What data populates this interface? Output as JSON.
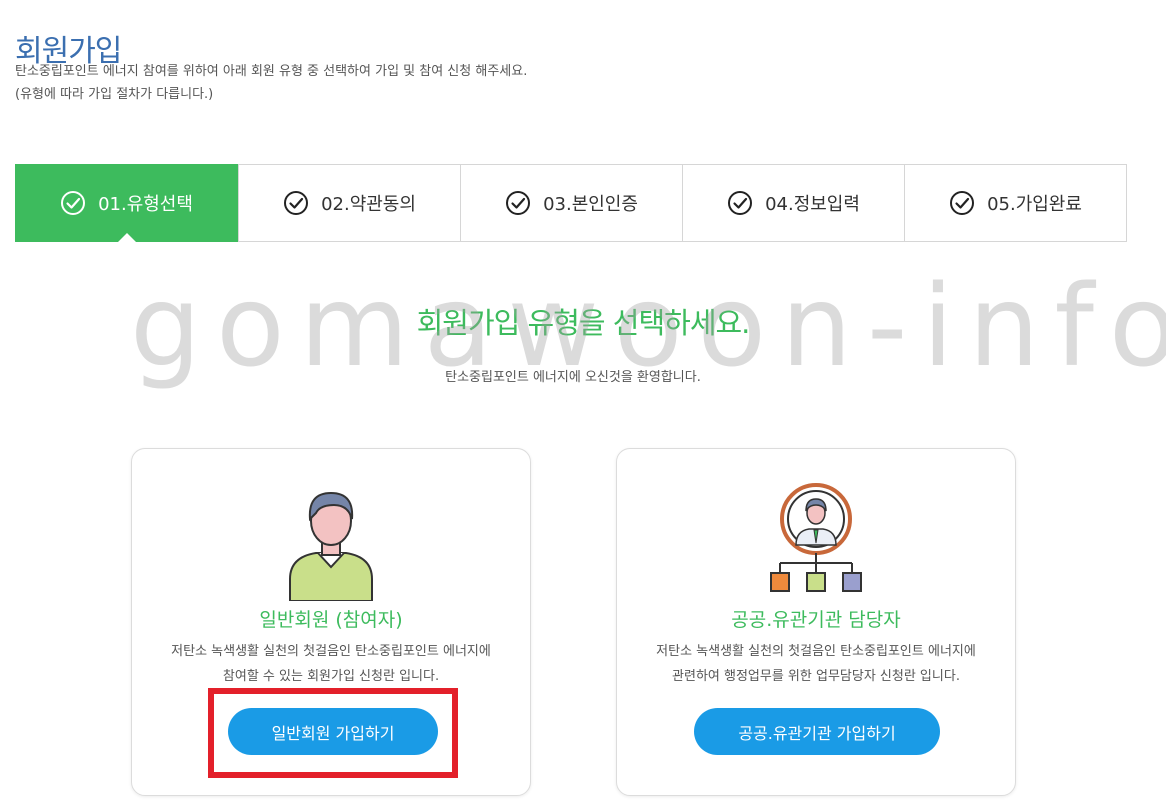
{
  "page": {
    "title": "회원가입",
    "intro_line1": "탄소중립포인트 에너지 참여를 위하여 아래 회원 유형 중 선택하여 가입 및 참여 신청 해주세요.",
    "intro_line2": "(유형에 따라 가입 절차가 다릅니다.)"
  },
  "steps": [
    {
      "label": "01.유형선택",
      "active": true
    },
    {
      "label": "02.약관동의",
      "active": false
    },
    {
      "label": "03.본인인증",
      "active": false
    },
    {
      "label": "04.정보입력",
      "active": false
    },
    {
      "label": "05.가입완료",
      "active": false
    }
  ],
  "selection": {
    "title": "회원가입 유형을 선택하세요.",
    "subtitle": "탄소중립포인트 에너지에 오신것을 환영합니다."
  },
  "watermark": "gomawoon-info",
  "cards": [
    {
      "title": "일반회원 (참여자)",
      "desc_line1": "저탄소 녹색생활 실천의 첫걸음인 탄소중립포인트 에너지에",
      "desc_line2": "참여할 수 있는 회원가입 신청란 입니다.",
      "button": "일반회원 가입하기"
    },
    {
      "title": "공공.유관기관 담당자",
      "desc_line1": "저탄소 녹색생활 실천의 첫걸음인 탄소중립포인트 에너지에",
      "desc_line2": "관련하여 행정업무를 위한 업무담당자 신청란 입니다.",
      "button": "공공.유관기관 가입하기"
    }
  ],
  "colors": {
    "accent_green": "#3dbb5d",
    "title_blue": "#3b6fb0",
    "button_blue": "#1a9be6",
    "highlight_red": "#e3202a"
  }
}
